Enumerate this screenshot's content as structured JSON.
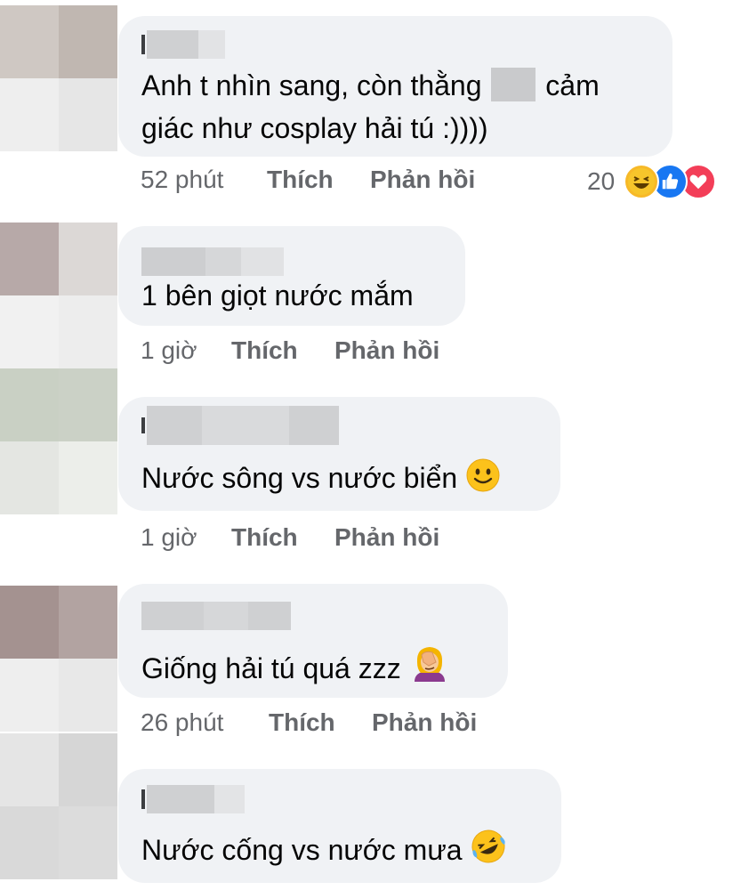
{
  "colors": {
    "bubble": "#f0f2f5",
    "meta_text": "#65676b",
    "text": "#050505",
    "like_blue": "#1877f2",
    "love_red": "#f33e58"
  },
  "comments": [
    {
      "lines": [
        "Anh t nhìn sang, còn thằng",
        "cảm",
        "giác như cosplay hải tú :))))"
      ],
      "time": "52 phút",
      "like": "Thích",
      "reply": "Phản hồi",
      "reaction_count": "20",
      "reaction_icons": [
        "haha-icon",
        "like-icon",
        "love-icon"
      ]
    },
    {
      "text": "1 bên giọt nước mắm",
      "time": "1 giờ",
      "like": "Thích",
      "reply": "Phản hồi"
    },
    {
      "text": "Nước sông vs nước biển",
      "emoji": "slightly-smiling-face-icon",
      "time": "1 giờ",
      "like": "Thích",
      "reply": "Phản hồi"
    },
    {
      "text": "Giống hải tú quá zzz",
      "emoji": "facepalm-icon",
      "time": "26 phút",
      "like": "Thích",
      "reply": "Phản hồi"
    },
    {
      "text": "Nước cống vs nước mưa",
      "emoji": "rolling-laughing-icon"
    }
  ]
}
